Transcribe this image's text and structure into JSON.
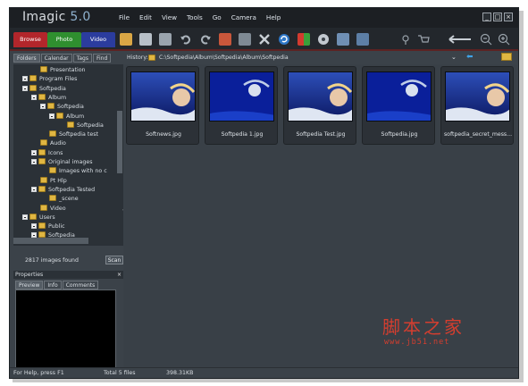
{
  "app": {
    "title": "Imagic",
    "version": "5.0"
  },
  "menu": [
    "File",
    "Edit",
    "View",
    "Tools",
    "Go",
    "Camera",
    "Help"
  ],
  "window_controls": {
    "minimize": "_",
    "maximize": "□",
    "close": "×"
  },
  "modes": [
    {
      "label": "Browse",
      "color": "#b3262b"
    },
    {
      "label": "Photo",
      "color": "#2f8f2f"
    },
    {
      "label": "Video",
      "color": "#2b3c9e"
    }
  ],
  "toolbar_icons": [
    "scanner-icon",
    "print-icon",
    "print-preview-icon",
    "undo-icon",
    "redo-icon",
    "edit-icon",
    "delete-icon",
    "cut-icon",
    "refresh-icon",
    "slideshow-icon",
    "cd-icon",
    "properties-icon",
    "webpage-icon",
    "camera-icon",
    "cart-icon",
    "arrow-icon",
    "zoom-out-icon",
    "zoom-in-icon"
  ],
  "left_panel": {
    "tabs": [
      "Folders",
      "Calendar",
      "Tags",
      "Find"
    ],
    "active_tab": "Folders",
    "tree": [
      {
        "label": "Presentation",
        "depth": 1,
        "expander": false
      },
      {
        "label": "Program Files",
        "depth": 0,
        "expander": true
      },
      {
        "label": "Softpedia",
        "depth": 0,
        "expander": true
      },
      {
        "label": "Album",
        "depth": 1,
        "expander": true
      },
      {
        "label": "Softpedia",
        "depth": 2,
        "expander": true
      },
      {
        "label": "Album",
        "depth": 3,
        "expander": true
      },
      {
        "label": "Softpedia",
        "depth": 4,
        "expander": false
      },
      {
        "label": "Softpedia test",
        "depth": 2,
        "expander": false
      },
      {
        "label": "Audio",
        "depth": 1,
        "expander": false
      },
      {
        "label": "Icons",
        "depth": 1,
        "expander": true
      },
      {
        "label": "Original images",
        "depth": 1,
        "expander": true
      },
      {
        "label": "Images with no c",
        "depth": 2,
        "expander": false
      },
      {
        "label": "Pt Hlp",
        "depth": 1,
        "expander": false
      },
      {
        "label": "Softpedia Tested",
        "depth": 1,
        "expander": true
      },
      {
        "label": "_scene",
        "depth": 2,
        "expander": false
      },
      {
        "label": "Video",
        "depth": 1,
        "expander": false
      },
      {
        "label": "Users",
        "depth": 0,
        "expander": true
      },
      {
        "label": "Public",
        "depth": 1,
        "expander": true
      },
      {
        "label": "Softpedia",
        "depth": 1,
        "expander": true
      }
    ],
    "images_found": "2817 images found",
    "scan_button": "Scan"
  },
  "properties": {
    "title": "Properties",
    "close": "×",
    "tabs": [
      "Preview",
      "Info",
      "Comments"
    ],
    "active_tab": "Preview"
  },
  "history": {
    "label": "History:",
    "path": "C:\\Softpedia\\Album\\Softpedia\\Album\\Softpedia"
  },
  "thumbnails": [
    {
      "filename": "Softnews.jpg"
    },
    {
      "filename": "Softpedia 1.jpg"
    },
    {
      "filename": "Softpedia Test.jpg"
    },
    {
      "filename": "Softpedia.jpg"
    },
    {
      "filename": "softpedia_secret_mess..."
    }
  ],
  "status": {
    "help": "For Help, press F1",
    "total": "Total 5 files",
    "size": "398.31KB"
  },
  "watermark": {
    "title": "脚本之家",
    "url": "www.jb51.net"
  },
  "colors": {
    "window_bg": "#3b4249",
    "menu_bg": "#1c1f23",
    "accent_red": "#5c2222",
    "watermark": "#d43e2f"
  }
}
